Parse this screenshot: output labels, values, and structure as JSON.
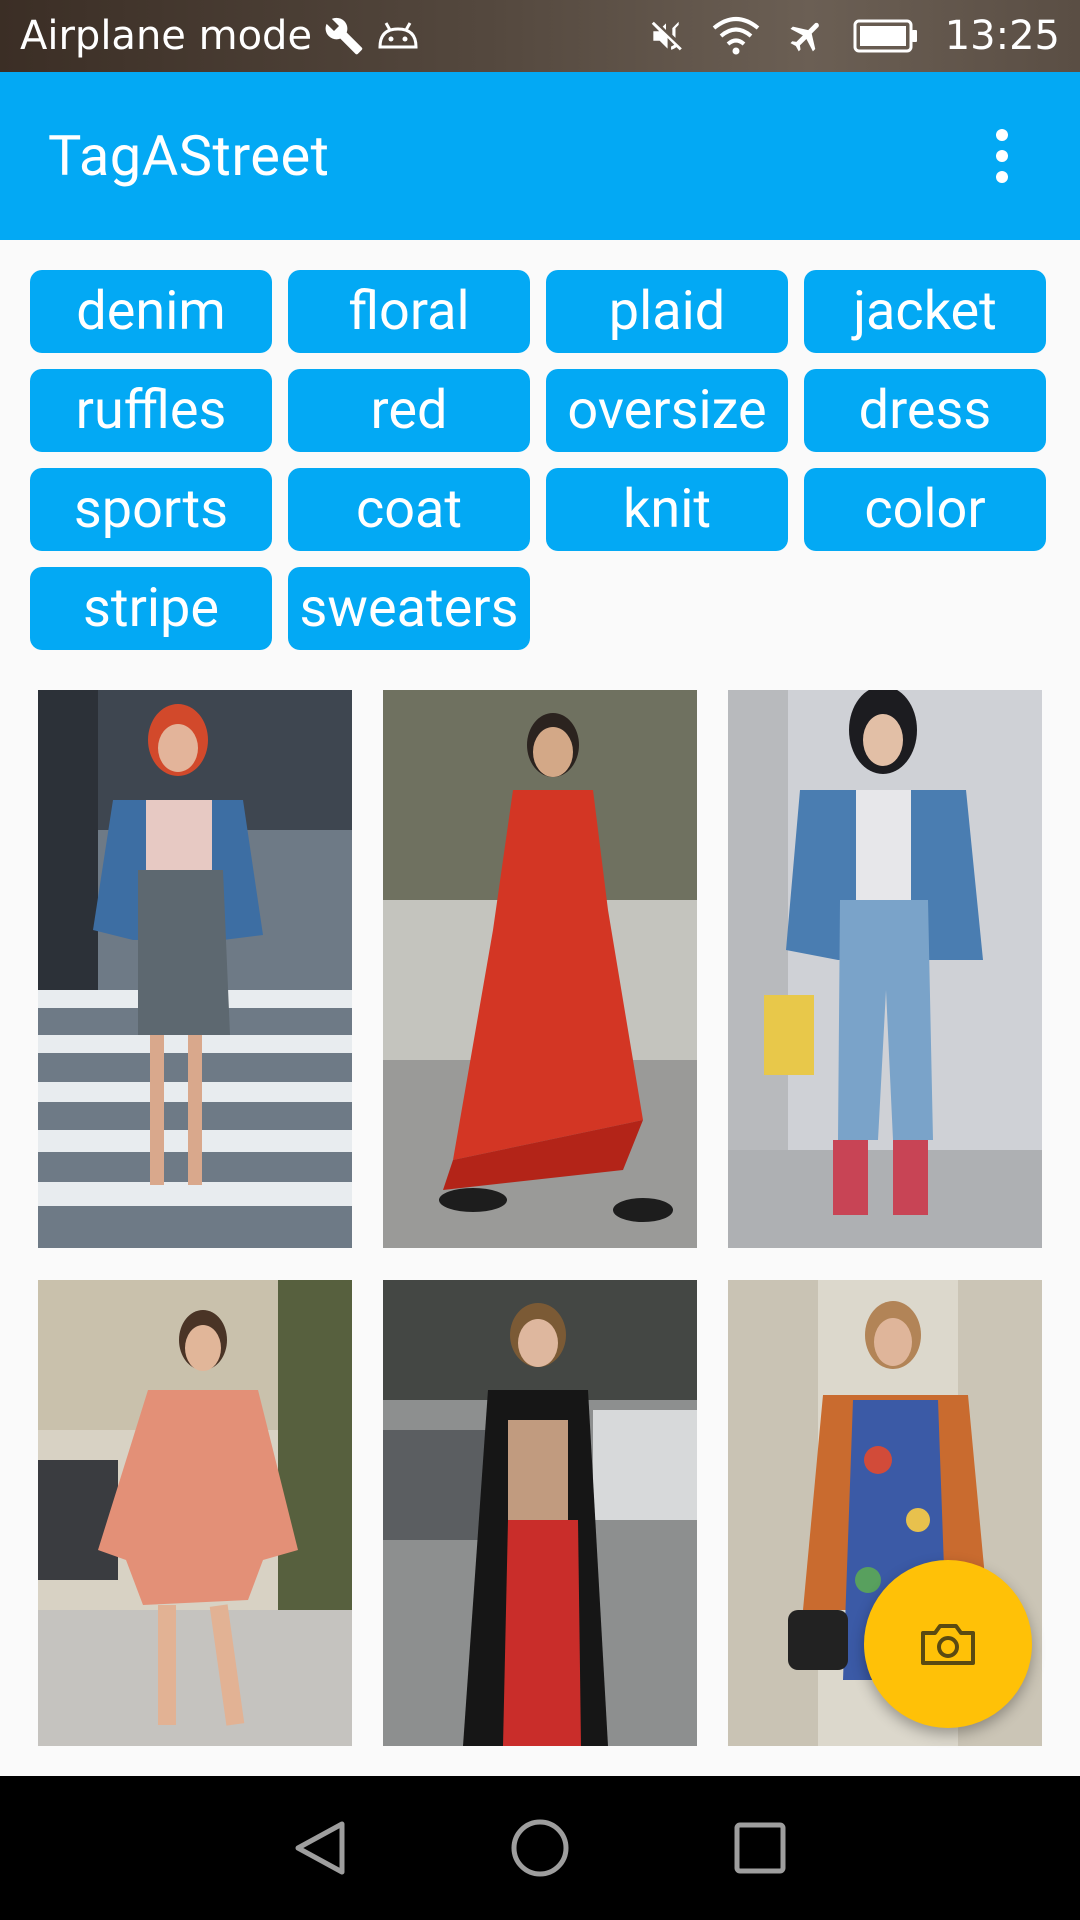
{
  "status_bar": {
    "mode_text": "Airplane mode",
    "time": "13:25",
    "icons": [
      "wrench-icon",
      "android-icon",
      "mute-icon",
      "wifi-icon",
      "airplane-icon",
      "battery-icon"
    ]
  },
  "app_bar": {
    "title": "TagAStreet",
    "menu_icon": "more-vert-icon"
  },
  "tags": [
    "denim",
    "floral",
    "plaid",
    "jacket",
    "ruffles",
    "red",
    "oversize",
    "dress",
    "sports",
    "coat",
    "knit",
    "color",
    "stripe",
    "sweaters"
  ],
  "photos": [
    {
      "name": "photo-denim-plaid-skirt"
    },
    {
      "name": "photo-red-dress"
    },
    {
      "name": "photo-denim-jacket-jeans"
    },
    {
      "name": "photo-pink-dress"
    },
    {
      "name": "photo-black-coat-red-pants"
    },
    {
      "name": "photo-floral-dress"
    }
  ],
  "fab": {
    "icon": "camera-icon"
  },
  "nav_bar": {
    "icons": [
      "back-icon",
      "home-icon",
      "recents-icon"
    ]
  },
  "colors": {
    "primary": "#03a9f4",
    "accent": "#ffc107",
    "background": "#fafafa"
  }
}
